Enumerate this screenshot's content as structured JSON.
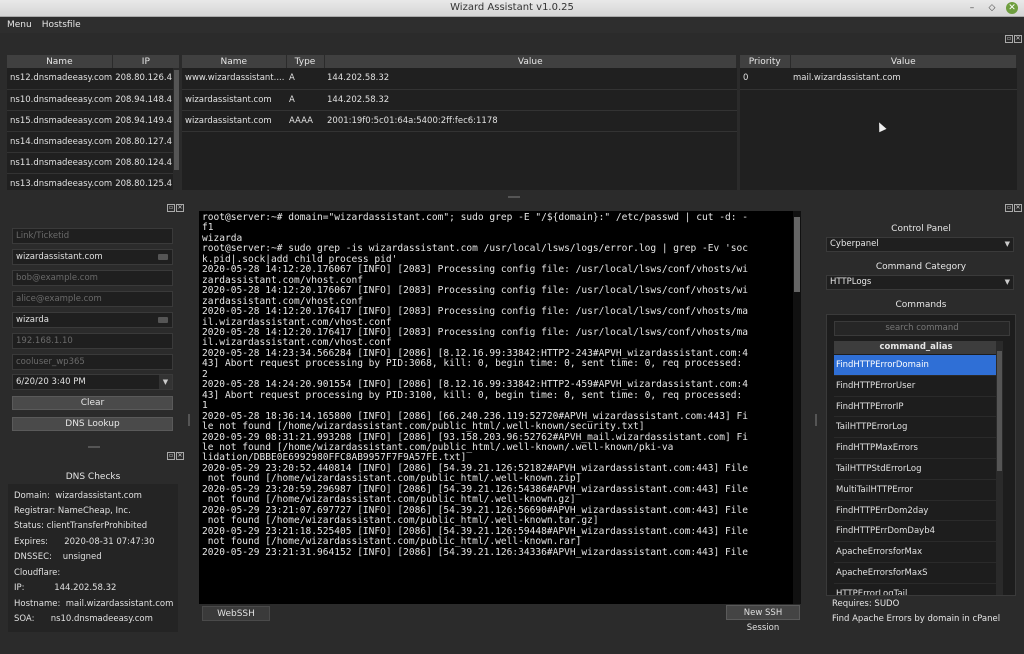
{
  "window": {
    "title": "Wizard Assistant v1.0.25"
  },
  "menu": {
    "items": [
      "Menu",
      "Hostsfile"
    ]
  },
  "ns_table": {
    "headers": [
      "Name",
      "IP"
    ],
    "rows": [
      [
        "ns12.dnsmadeeasy.com",
        "208.80.126.4"
      ],
      [
        "ns10.dnsmadeeasy.com",
        "208.94.148.4"
      ],
      [
        "ns15.dnsmadeeasy.com",
        "208.94.149.4"
      ],
      [
        "ns14.dnsmadeeasy.com",
        "208.80.127.4"
      ],
      [
        "ns11.dnsmadeeasy.com",
        "208.80.124.4"
      ],
      [
        "ns13.dnsmadeeasy.com",
        "208.80.125.4"
      ]
    ]
  },
  "records_table": {
    "headers": [
      "Name",
      "Type",
      "Value"
    ],
    "rows": [
      [
        "www.wizardassistant....",
        "A",
        "144.202.58.32"
      ],
      [
        "wizardassistant.com",
        "A",
        "144.202.58.32"
      ],
      [
        "wizardassistant.com",
        "AAAA",
        "2001:19f0:5c01:64a:5400:2ff:fec6:1178"
      ]
    ]
  },
  "mx_table": {
    "headers": [
      "Priority",
      "Value"
    ],
    "rows": [
      [
        "0",
        "mail.wizardassistant.com"
      ]
    ]
  },
  "form": {
    "ticket": {
      "placeholder": "Link/Ticketid"
    },
    "domain": {
      "value": "wizardassistant.com"
    },
    "email1": {
      "placeholder": "bob@example.com"
    },
    "email2": {
      "placeholder": "alice@example.com"
    },
    "user": {
      "value": "wizarda"
    },
    "ip": {
      "placeholder": "192.168.1.10"
    },
    "db": {
      "placeholder": "cooluser_wp365"
    },
    "datetime": {
      "value": "6/20/20 3:40 PM"
    },
    "clear_label": "Clear",
    "lookup_label": "DNS Lookup"
  },
  "dns_checks": {
    "title": "DNS Checks",
    "rows": [
      {
        "label": "Domain:",
        "value": "wizardassistant.com"
      },
      {
        "label": "Registrar:",
        "value": "NameCheap, Inc."
      },
      {
        "label": "Status:",
        "value": "clientTransferProhibited"
      },
      {
        "label": "Expires:",
        "value": "2020-08-31 07:47:30"
      },
      {
        "label": "DNSSEC:",
        "value": "unsigned"
      },
      {
        "label": "Cloudflare:",
        "value": ""
      },
      {
        "label": "IP:",
        "value": "144.202.58.32"
      },
      {
        "label": "Hostname:",
        "value": "mail.wizardassistant.com"
      },
      {
        "label": "SOA:",
        "value": "ns10.dnsmadeeasy.com"
      }
    ]
  },
  "terminal": {
    "lines": [
      "root@server:~# domain=\"wizardassistant.com\"; sudo grep -E \"/${domain}:\" /etc/passwd | cut -d: -",
      "f1",
      "wizarda",
      "root@server:~# sudo grep -is wizardassistant.com /usr/local/lsws/logs/error.log | grep -Ev 'soc",
      "k.pid|.sock|add child process pid'",
      "2020-05-28 14:12:20.176067 [INFO] [2083] Processing config file: /usr/local/lsws/conf/vhosts/wi",
      "zardassistant.com/vhost.conf",
      "2020-05-28 14:12:20.176067 [INFO] [2083] Processing config file: /usr/local/lsws/conf/vhosts/wi",
      "zardassistant.com/vhost.conf",
      "2020-05-28 14:12:20.176417 [INFO] [2083] Processing config file: /usr/local/lsws/conf/vhosts/ma",
      "il.wizardassistant.com/vhost.conf",
      "2020-05-28 14:12:20.176417 [INFO] [2083] Processing config file: /usr/local/lsws/conf/vhosts/ma",
      "il.wizardassistant.com/vhost.conf",
      "2020-05-28 14:23:34.566284 [INFO] [2086] [8.12.16.99:33842:HTTP2-243#APVH_wizardassistant.com:4",
      "43] Abort request processing by PID:3068, kill: 0, begin time: 0, sent time: 0, req processed:",
      "2",
      "2020-05-28 14:24:20.901554 [INFO] [2086] [8.12.16.99:33842:HTTP2-459#APVH_wizardassistant.com:4",
      "43] Abort request processing by PID:3100, kill: 0, begin time: 0, sent time: 0, req processed:",
      "1",
      "2020-05-28 18:36:14.165800 [INFO] [2086] [66.240.236.119:52720#APVH_wizardassistant.com:443] Fi",
      "le not found [/home/wizardassistant.com/public_html/.well-known/security.txt]",
      "2020-05-29 08:31:21.993208 [INFO] [2086] [93.158.203.96:52762#APVH_mail.wizardassistant.com] Fi",
      "le not found [/home/wizardassistant.com/public_html/.well-known/.well-known/pki-va",
      "lidation/DBBE0E6992980FFC8AB9957F7F9A57FE.txt]",
      "2020-05-29 23:20:52.440814 [INFO] [2086] [54.39.21.126:52182#APVH_wizardassistant.com:443] File",
      " not found [/home/wizardassistant.com/public_html/.well-known.zip]",
      "2020-05-29 23:20:59.296987 [INFO] [2086] [54.39.21.126:54386#APVH_wizardassistant.com:443] File",
      " not found [/home/wizardassistant.com/public_html/.well-known.gz]",
      "2020-05-29 23:21:07.697727 [INFO] [2086] [54.39.21.126:56690#APVH_wizardassistant.com:443] File",
      " not found [/home/wizardassistant.com/public_html/.well-known.tar.gz]",
      "2020-05-29 23:21:18.525405 [INFO] [2086] [54.39.21.126:59448#APVH_wizardassistant.com:443] File",
      " not found [/home/wizardassistant.com/public_html/.well-known.rar]",
      "2020-05-29 23:21:31.964152 [INFO] [2086] [54.39.21.126:34336#APVH_wizardassistant.com:443] File"
    ],
    "tab_label": "WebSSH",
    "new_session_label": "New SSH Session"
  },
  "control_panel": {
    "label": "Control Panel",
    "value": "Cyberpanel",
    "category_label": "Command Category",
    "category_value": "HTTPLogs",
    "commands_label": "Commands",
    "search_placeholder": "search command",
    "column_header": "command_alias",
    "commands": [
      "FindHTTPErrorDomain",
      "FindHTTPErrorUser",
      "FindHTTPErrorIP",
      "TailHTTPErrorLog",
      "FindHTTPMaxErrors",
      "TailHTTPStdErrorLog",
      "MultiTailHTTPError",
      "FindHTTPErrDom2day",
      "FindHTTPErrDomDayb4",
      "ApacheErrorsforMax",
      "ApacheErrorsforMaxS",
      "HTTPErrorLogTail"
    ],
    "requires": "Requires: SUDO",
    "description": "Find Apache Errors by domain in cPanel"
  }
}
